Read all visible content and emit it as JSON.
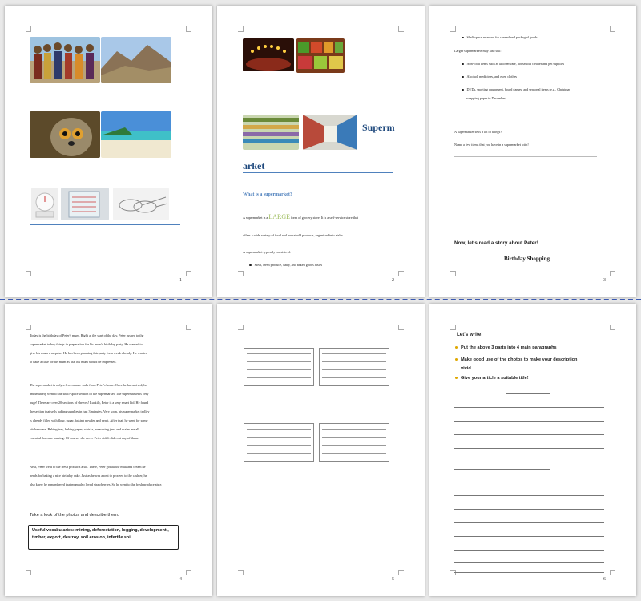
{
  "pages": {
    "p1": {
      "number": "1"
    },
    "p2": {
      "number": "2",
      "title_part1": "Superm",
      "title_part2": "arket",
      "question": "What is a supermarket?",
      "line1_a": "A supermarket is a ",
      "line1_large": "LARGE",
      "line1_b": " form of grocery store. It is a self-service store that",
      "line2": "offers a wide variety of food and household products, organized into aisles.",
      "line3": "A supermarket typically consists of:",
      "bullet1": "Meat, fresh produce, dairy, and baked goods aisles"
    },
    "p3": {
      "number": "3",
      "bullet_shelf": "Shelf space reserved for canned and packaged goods",
      "larger_intro": "Larger supermarkets may also sell:",
      "b1": "Non-food items such as kitchenware, household cleaner and pet supplies",
      "b2": "Alcohol, medicines, and even clothes",
      "b3": "DVDs, sporting equipment, board games, and seasonal items (e.g., Christmas",
      "b3b": "wrapping paper in December)",
      "q1": "A supermarket sells a lot of things?",
      "q2": "Name a few items that you have in a supermarket with!",
      "story_intro": "Now, let's read a story about Peter!",
      "story_title": "Birthday Shopping"
    },
    "p4": {
      "number": "4",
      "para1": [
        "Today is the birthday of Peter's mum. Right at the start of the day, Peter rushed to the",
        "supermarket to buy things in preparation for his mum's birthday party. He wanted to",
        "give his mum a surprise. He has been planning this party for a week already. He wanted",
        "to bake a cake for his mum as that his mum would be impressed."
      ],
      "para2": [
        "The supermarket is only a five-minute walk from Peter's home. Once he has arrived, he",
        "immediately went to the shelf-space section of the supermarket. The supermarket is very",
        "huge! There are over 20 sections of shelves! Luckily, Peter is a very smart kid. He found",
        "the section that sells baking supplies in just 3 minutes. Very soon, his supermarket trolley",
        "is already filled with flour, sugar, baking powder and yeast. After that, he went for some",
        "kitchenware. Baking tray, baking paper, whisks, measuring jars, and scales are all",
        "essential for cake making. Of course, she drove Peter didn't dish out any of them."
      ],
      "para3": [
        "Next, Peter went to the fresh products aisle. There, Peter got all the milk and cream he",
        "needs for baking a nice birthday cake. Just as he was about to proceed to the cashier, he",
        "also knew he remembered that mum also loved strawberries. So he went to the fresh produce aisle."
      ],
      "prompt": "Take a look of the photos and describe them.",
      "vocab": "Useful vocabularies: mining, deforestation, logging, development , timber, export, destroy, soil erosion, infertile soil"
    },
    "p5": {
      "number": "5"
    },
    "p6": {
      "number": "6",
      "heading": "Let's write!",
      "i1": "Put the above 3 parts into 4 main paragraphs",
      "i2": "Make good use of the photos to make your description",
      "i2b": "vivid..",
      "i3": "Give your article a suitable title!"
    }
  },
  "colors": {
    "heading_blue": "#1f497d",
    "large_word_green": "#9bbb59",
    "bullet_yellow": "#e0a800",
    "rule_blue": "#4f81bd"
  },
  "photos": [
    "women-carrying-baskets-photo",
    "rocky-mountain-landscape-photo",
    "lemur-photo",
    "tropical-beach-photo",
    "kitchen-scale-photo",
    "measuring-jug-photo",
    "whisks-photo",
    "birthday-candles-photo",
    "fresh-produce-photo",
    "supermarket-shelves-photo",
    "supermarket-aisle-photo"
  ]
}
